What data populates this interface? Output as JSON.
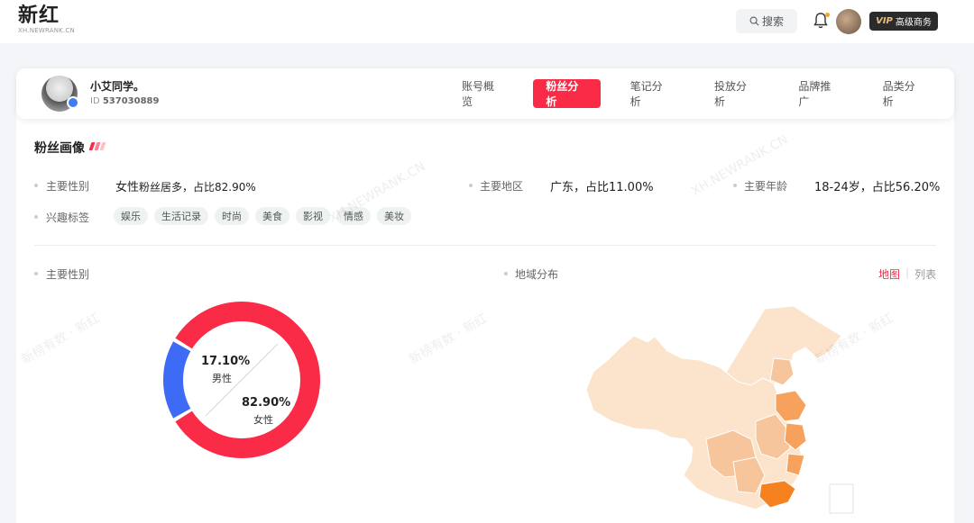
{
  "header": {
    "logo_text": "新红",
    "logo_sub": "XH.NEWRANK.CN",
    "search_label": "搜索",
    "vip_label": "VIP",
    "vip_text": "高级商务"
  },
  "profile": {
    "name": "小艾同学。",
    "id_label": "ID",
    "id_value": "537030889"
  },
  "tabs": [
    {
      "label": "账号概览",
      "active": false
    },
    {
      "label": "粉丝分析",
      "active": true
    },
    {
      "label": "笔记分析",
      "active": false
    },
    {
      "label": "投放分析",
      "active": false
    },
    {
      "label": "品牌推广",
      "active": false
    },
    {
      "label": "品类分析",
      "active": false
    }
  ],
  "section": {
    "title": "粉丝画像",
    "gender": {
      "label": "主要性别",
      "value_main": "女性",
      "value_sub": "粉丝居多，占比82.90%"
    },
    "region": {
      "label": "主要地区",
      "value": "广东，占比11.00%"
    },
    "age": {
      "label": "主要年龄",
      "value": "18-24岁，占比56.20%"
    },
    "interests": {
      "label": "兴趣标签",
      "tags": [
        "娱乐",
        "生活记录",
        "时尚",
        "美食",
        "影视",
        "情感",
        "美妆"
      ]
    }
  },
  "gender_chart": {
    "title": "主要性别",
    "male_pct": "17.10%",
    "male_label": "男性",
    "female_pct": "82.90%",
    "female_label": "女性"
  },
  "region_chart": {
    "title": "地域分布",
    "view_map": "地图",
    "view_list": "列表"
  },
  "watermarks": [
    "XH.NEWRANK.CN",
    "新榜有数 · 新红"
  ],
  "colors": {
    "accent": "#fa2b47",
    "male": "#3d6bf5",
    "female": "#fa2b47",
    "map_light": "#fbe5cf",
    "map_mid": "#f7b98a",
    "map_dark": "#f5821f"
  },
  "chart_data": {
    "type": "pie",
    "title": "主要性别",
    "categories": [
      "男性",
      "女性"
    ],
    "values": [
      17.1,
      82.9
    ]
  }
}
